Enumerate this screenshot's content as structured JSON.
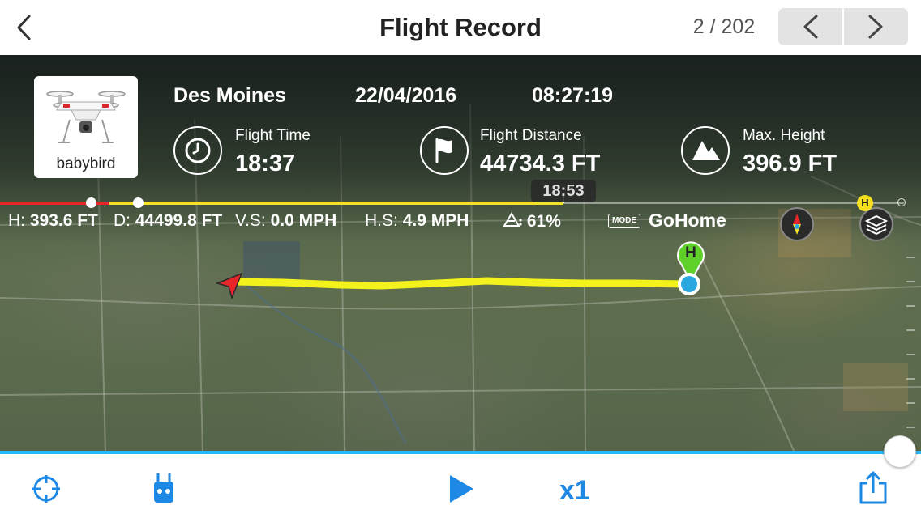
{
  "header": {
    "title": "Flight Record",
    "page_counter": "2 / 202"
  },
  "flight": {
    "aircraft_name": "babybird",
    "location": "Des Moines",
    "date": "22/04/2016",
    "time": "08:27:19",
    "stats": {
      "flight_time_label": "Flight Time",
      "flight_time_value": "18:37",
      "flight_distance_label": "Flight Distance",
      "flight_distance_value": "44734.3 FT",
      "max_height_label": "Max. Height",
      "max_height_value": "396.9 FT"
    }
  },
  "timeline": {
    "current_time": "18:53"
  },
  "telemetry": {
    "height_label": "H:",
    "height_value": "393.6 FT",
    "distance_label": "D:",
    "distance_value": "44499.8 FT",
    "vs_label": "V.S:",
    "vs_value": "0.0 MPH",
    "hs_label": "H.S:",
    "hs_value": "4.9 MPH",
    "battery_value": "61%",
    "mode_tag": "MODE",
    "mode_value": "GoHome",
    "home_marker": "H"
  },
  "playback": {
    "speed": "x1"
  },
  "colors": {
    "accent": "#1e88e5",
    "track": "#f4f21c",
    "timeline_red": "#e8262a",
    "home_green": "#5fcf2a"
  },
  "icons": [
    "back-icon",
    "prev-icon",
    "next-icon",
    "clock-icon",
    "flag-icon",
    "mountain-icon",
    "battery-icon",
    "compass-icon",
    "layers-icon",
    "locate-icon",
    "remote-controller-icon",
    "play-icon",
    "share-icon"
  ]
}
